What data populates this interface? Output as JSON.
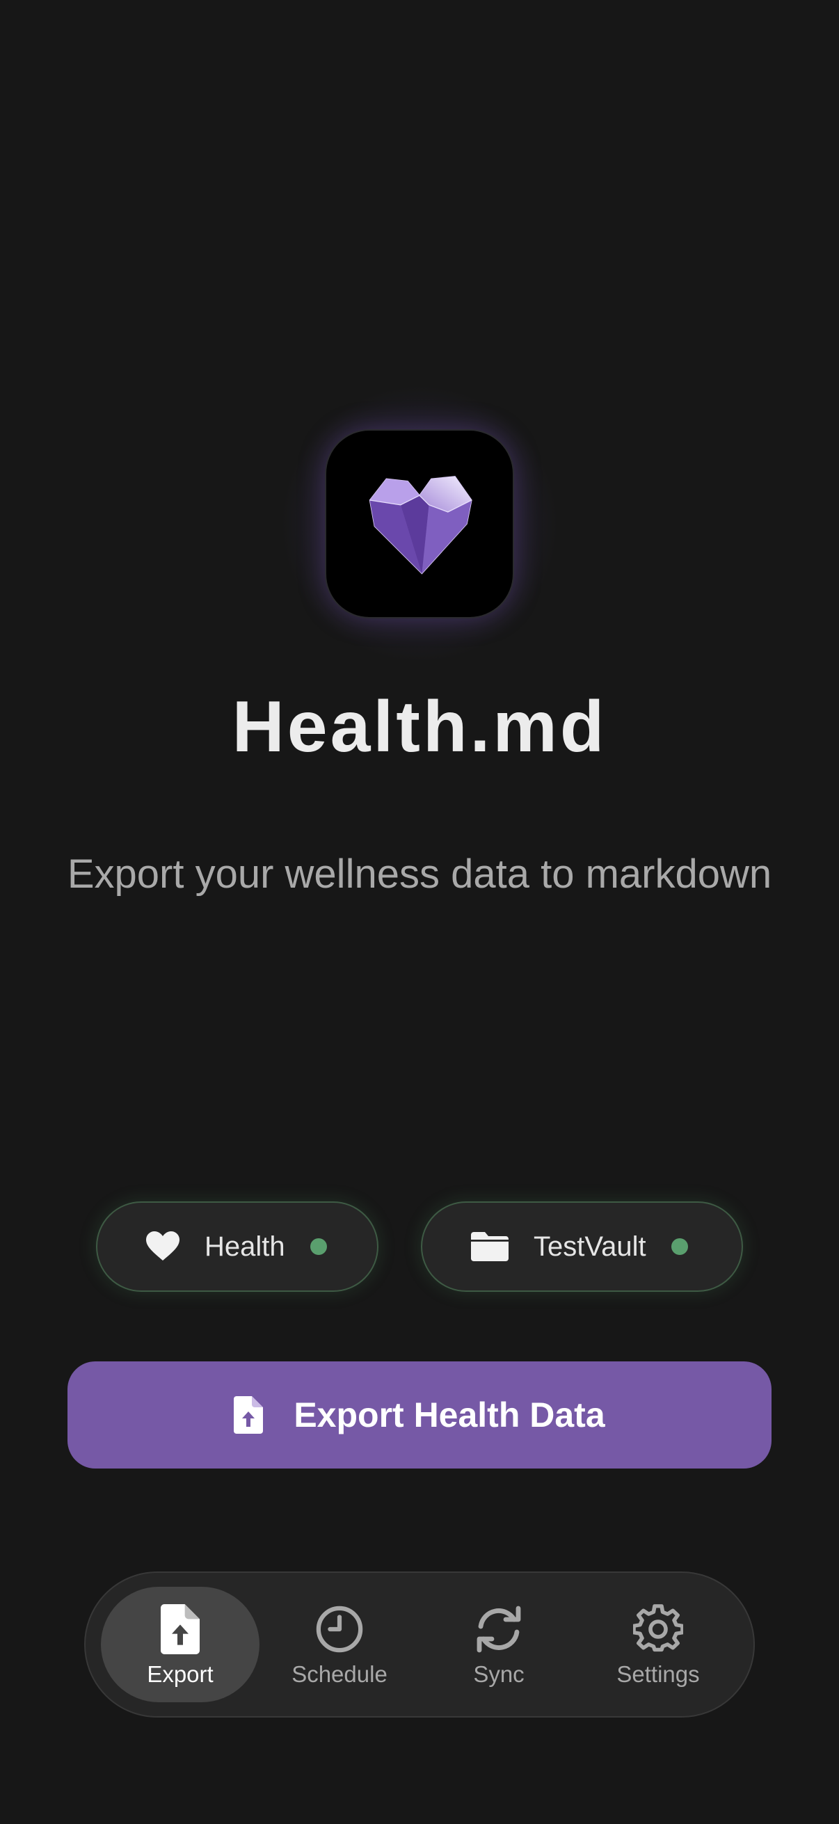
{
  "app": {
    "title": "Health.md",
    "tagline": "Export your wellness data to markdown",
    "icon": "amethyst-heart-icon"
  },
  "connections": [
    {
      "label": "Health",
      "icon": "heart-icon",
      "status": "connected",
      "status_color": "#5a9f6e"
    },
    {
      "label": "TestVault",
      "icon": "folder-icon",
      "status": "connected",
      "status_color": "#5a9f6e"
    }
  ],
  "primary_action": {
    "label": "Export Health Data",
    "icon": "document-upload-icon",
    "color": "#7659a6"
  },
  "tabbar": {
    "active": "Export",
    "tabs": [
      {
        "label": "Export",
        "icon": "document-upload-icon"
      },
      {
        "label": "Schedule",
        "icon": "clock-icon"
      },
      {
        "label": "Sync",
        "icon": "sync-icon"
      },
      {
        "label": "Settings",
        "icon": "gear-icon"
      }
    ]
  }
}
